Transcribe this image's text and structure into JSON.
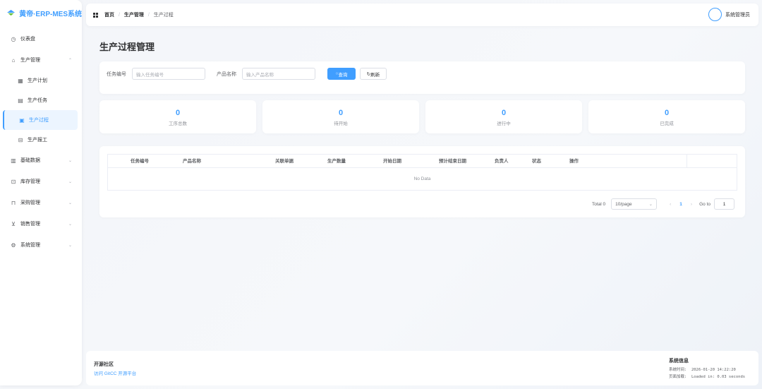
{
  "app": {
    "logo_text": "黄帝·ERP-MES系统",
    "colors": {
      "primary": "#409eff",
      "active_bg": "#ecf5ff"
    }
  },
  "sidebar": {
    "items": [
      {
        "label": "仪表盘",
        "icon": "dashboard-icon"
      },
      {
        "label": "生产管理",
        "icon": "factory-icon",
        "expanded": true
      },
      {
        "label": "生产计划",
        "icon": "calendar-icon"
      },
      {
        "label": "生产任务",
        "icon": "task-icon"
      },
      {
        "label": "生产过程",
        "icon": "process-icon",
        "active": true
      },
      {
        "label": "生产报工",
        "icon": "report-icon"
      },
      {
        "label": "基础数据",
        "icon": "database-icon"
      },
      {
        "label": "库存管理",
        "icon": "warehouse-icon"
      },
      {
        "label": "采购管理",
        "icon": "purchase-icon"
      },
      {
        "label": "销售管理",
        "icon": "cart-icon"
      },
      {
        "label": "系统管理",
        "icon": "gear-icon"
      }
    ]
  },
  "header": {
    "breadcrumb": [
      "首页",
      "生产管理",
      "生产过程"
    ],
    "user_name": "系统管理员"
  },
  "main": {
    "title": "生产过程管理",
    "search": {
      "task_label": "任务编号",
      "task_placeholder": "输入任务编号",
      "product_label": "产品名称",
      "product_placeholder": "输入产品名称",
      "query_label": "查询",
      "refresh_label": "刷新"
    },
    "stats": [
      {
        "value": "0",
        "label": "工序总数"
      },
      {
        "value": "0",
        "label": "待开始"
      },
      {
        "value": "0",
        "label": "进行中"
      },
      {
        "value": "0",
        "label": "已完成"
      }
    ],
    "table": {
      "columns": [
        "任务编号",
        "产品名称",
        "关联单据",
        "生产数量",
        "开始日期",
        "预计结束日期",
        "负责人",
        "状态",
        "操作"
      ],
      "empty_text": "No Data"
    },
    "pagination": {
      "total": "Total 0",
      "page_size": "10/page",
      "current": "1",
      "goto_label": "Go to",
      "goto_value": "1"
    }
  },
  "footer": {
    "community_title": "开源社区",
    "community_link": "访问 GitCC 开源平台",
    "sysinfo_title": "系统信息",
    "time_label": "系统时间:",
    "time_value": "2026-01-20 14:22:20",
    "load_label": "页面加载:",
    "load_value": "Loaded in: 0.03 seconds"
  }
}
